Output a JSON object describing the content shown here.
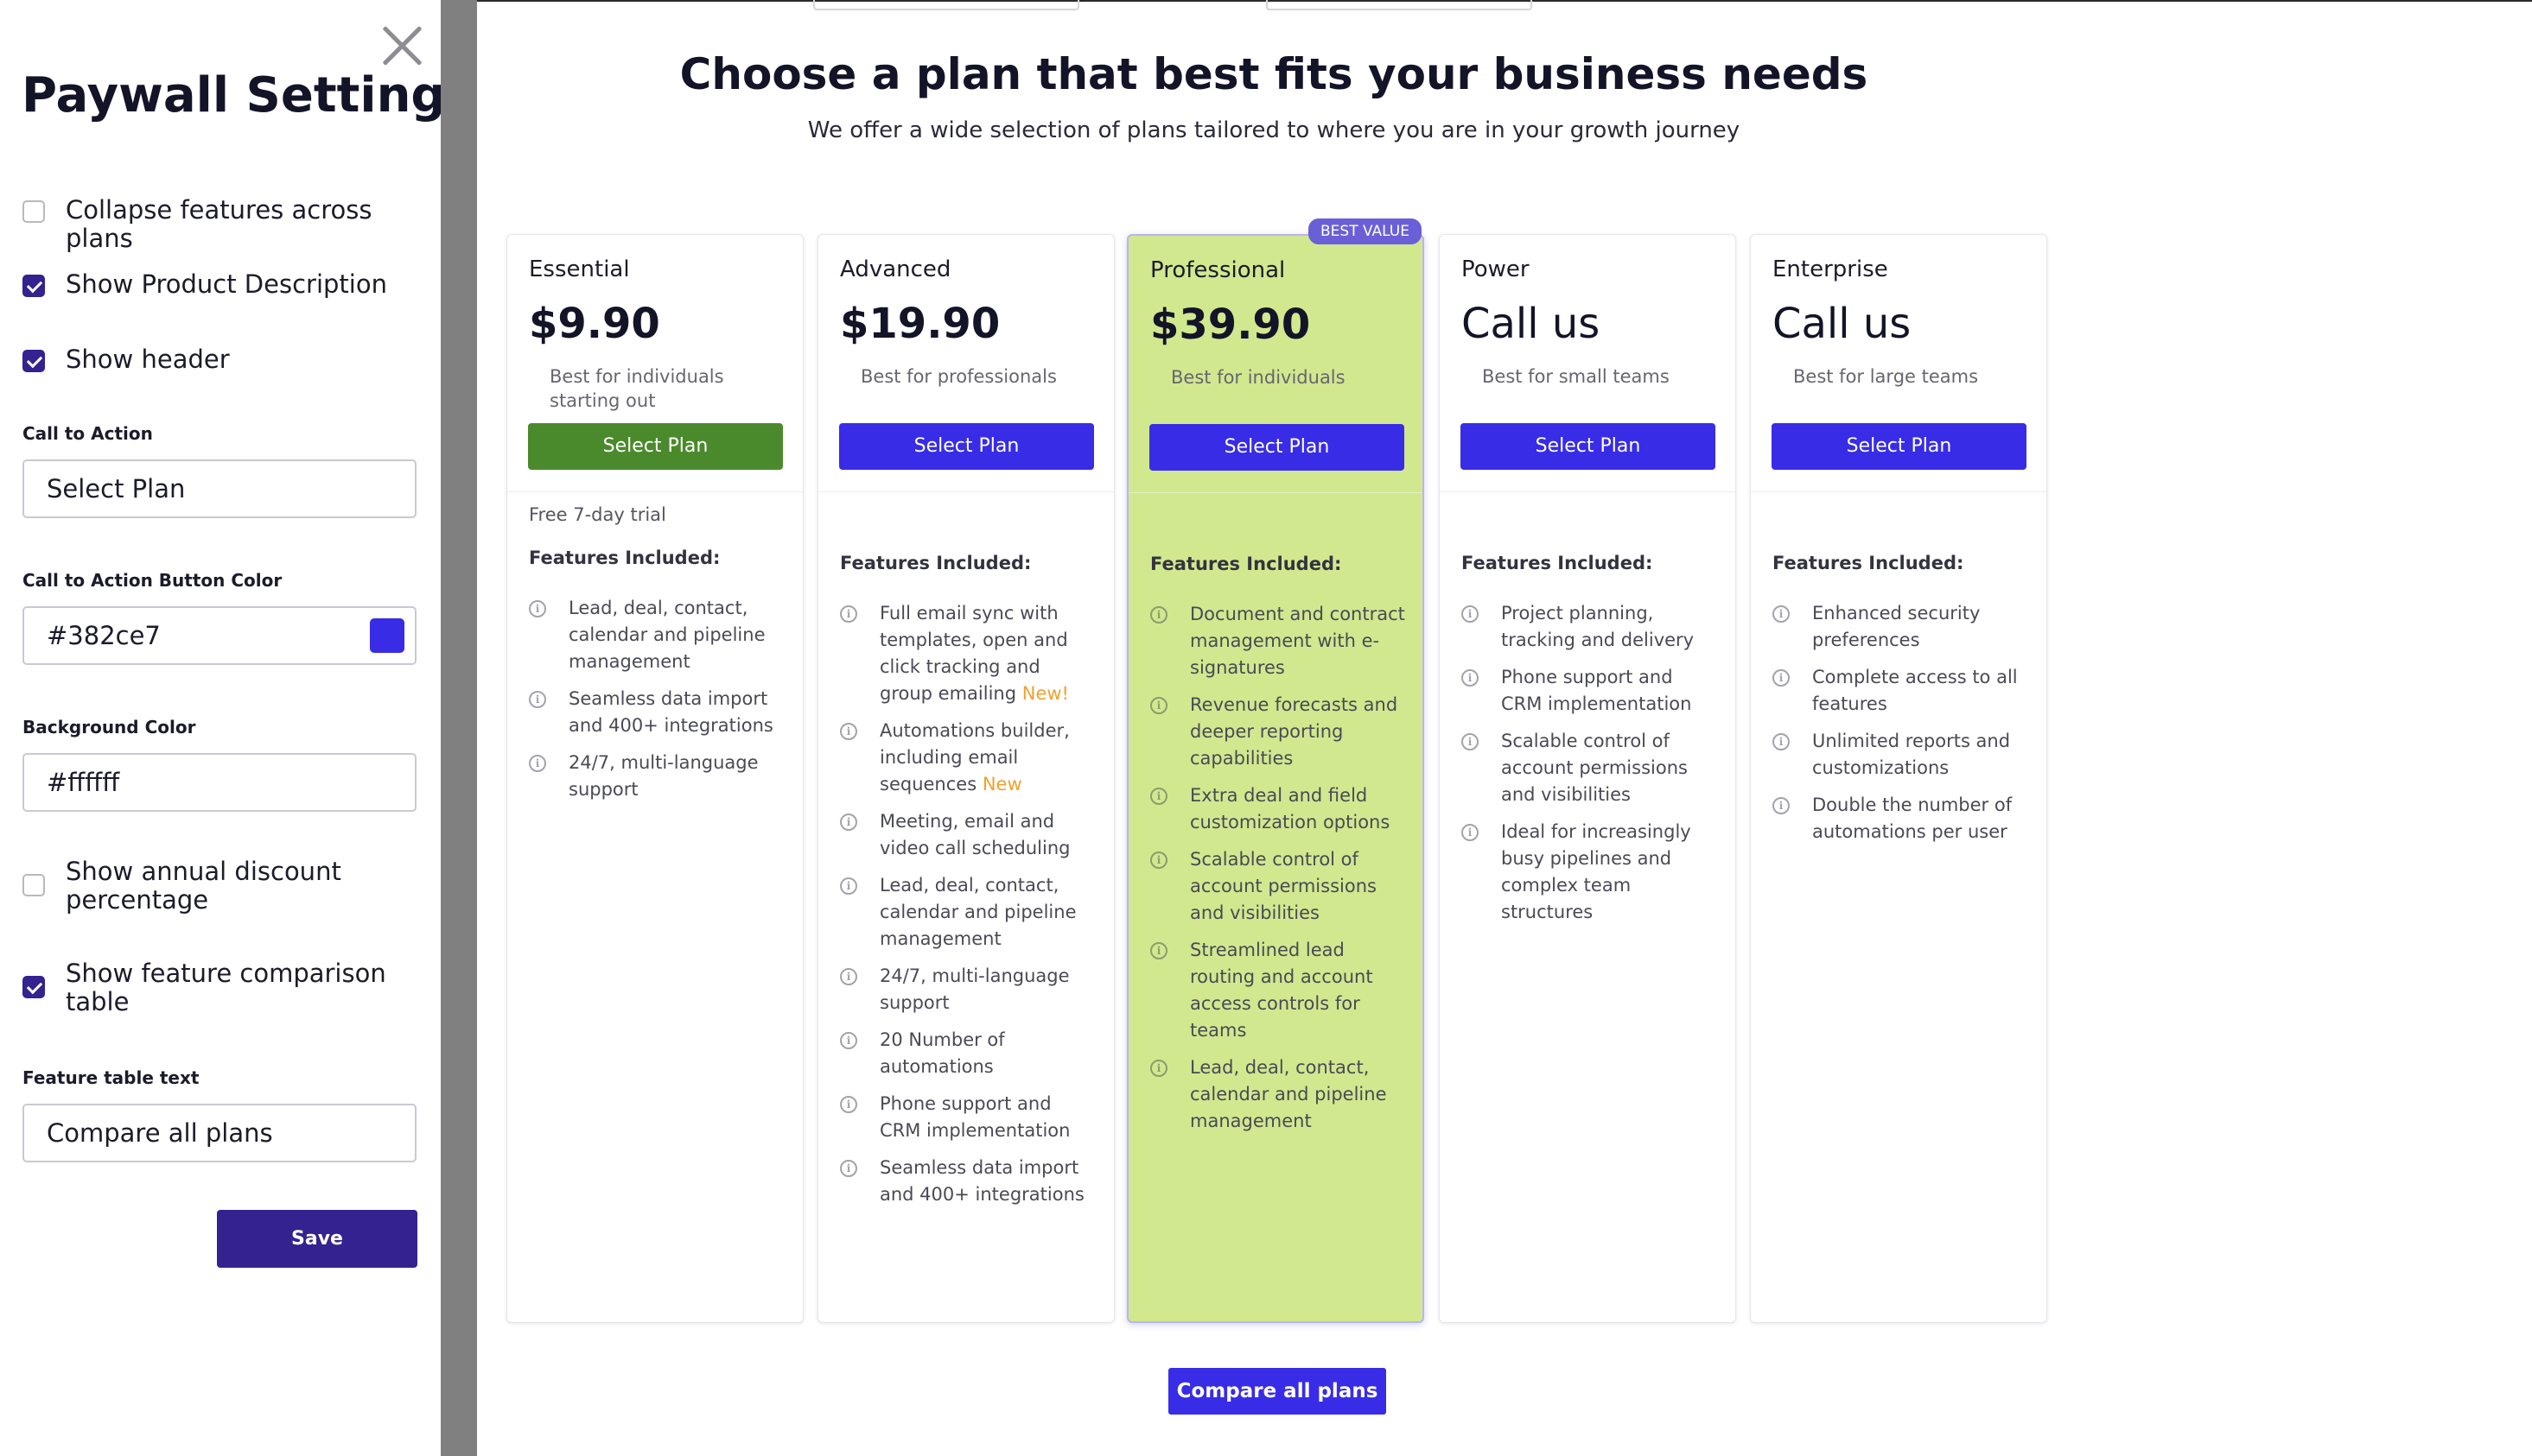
{
  "settings": {
    "title": "Paywall Settings",
    "checkboxes": [
      {
        "label": "Collapse features across plans",
        "checked": false
      },
      {
        "label": "Show Product Description",
        "checked": true
      },
      {
        "label": "Show header",
        "checked": true
      },
      {
        "label": "Show annual discount percentage",
        "checked": false
      },
      {
        "label": "Show feature comparison table",
        "checked": true
      }
    ],
    "cta_label": "Call to Action",
    "cta_value": "Select Plan",
    "cta_color_label": "Call to Action Button Color",
    "cta_color_value": "#382ce7",
    "bg_color_label": "Background Color",
    "bg_color_value": "#ffffff",
    "feature_table_label": "Feature table text",
    "feature_table_value": "Compare all plans",
    "save_label": "Save"
  },
  "header": {
    "title": "Choose a plan that best fits your business needs",
    "subtitle": "We offer a wide selection of plans tailored to where you are in your growth journey"
  },
  "plans": [
    {
      "name": "Essential",
      "price": "$9.90",
      "desc": "Best for individuals starting out",
      "cta": "Select Plan",
      "trial": "Free 7-day trial",
      "features_title": "Features Included:",
      "features": [
        {
          "text": "Lead, deal, contact, calendar and pipeline management"
        },
        {
          "text": "Seamless data import and 400+ integrations"
        },
        {
          "text": "24/7, multi-language support"
        }
      ]
    },
    {
      "name": "Advanced",
      "price": "$19.90",
      "desc": "Best for professionals",
      "cta": "Select Plan",
      "features_title": "Features Included:",
      "features": [
        {
          "text": "Full email sync with templates, open and click tracking and group emailing",
          "tag": "New!"
        },
        {
          "text": "Automations builder, including email sequences",
          "tag": "New"
        },
        {
          "text": "Meeting, email and video call scheduling"
        },
        {
          "text": "Lead, deal, contact, calendar and pipeline management"
        },
        {
          "text": "24/7, multi-language support"
        },
        {
          "text": "20 Number of automations"
        },
        {
          "text": "Phone support and CRM implementation"
        },
        {
          "text": "Seamless data import and 400+ integrations"
        }
      ]
    },
    {
      "name": "Professional",
      "price": "$39.90",
      "desc": "Best for individuals",
      "badge": "BEST VALUE",
      "cta": "Select Plan",
      "features_title": "Features Included:",
      "features": [
        {
          "text": "Document and contract management with e-signatures"
        },
        {
          "text": "Revenue forecasts and deeper reporting capabilities"
        },
        {
          "text": "Extra deal and field customization options"
        },
        {
          "text": "Scalable control of account permissions and visibilities"
        },
        {
          "text": "Streamlined lead routing and account access controls for teams"
        },
        {
          "text": "Lead, deal, contact, calendar and pipeline management"
        }
      ]
    },
    {
      "name": "Power",
      "price": "Call us",
      "desc": "Best for small teams",
      "cta": "Select Plan",
      "features_title": "Features Included:",
      "features": [
        {
          "text": "Project planning, tracking and delivery"
        },
        {
          "text": "Phone support and CRM implementation"
        },
        {
          "text": "Scalable control of account permissions and visibilities"
        },
        {
          "text": "Ideal for increasingly busy pipelines and complex team structures"
        }
      ]
    },
    {
      "name": "Enterprise",
      "price": "Call us",
      "desc": "Best for large teams",
      "cta": "Select Plan",
      "features_title": "Features Included:",
      "features": [
        {
          "text": "Enhanced security preferences"
        },
        {
          "text": "Complete access to all features"
        },
        {
          "text": "Unlimited reports and customizations"
        },
        {
          "text": "Double the number of automations per user"
        }
      ]
    }
  ],
  "compare_button": "Compare all plans",
  "colors": {
    "cta": "#382ce7",
    "essential_cta": "#4a8a2c",
    "highlight_card": "#d1e88f",
    "save": "#33228f"
  }
}
